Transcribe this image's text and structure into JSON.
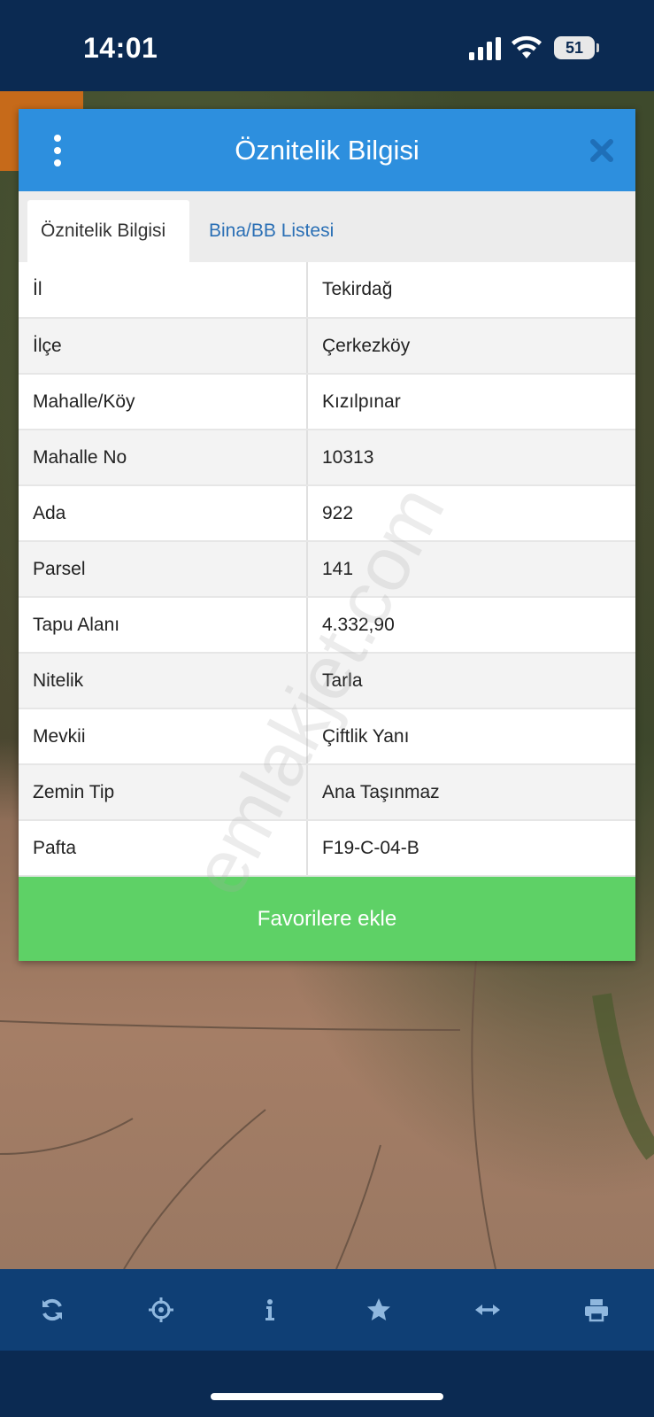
{
  "status_bar": {
    "time": "14:01",
    "battery_level": "51",
    "icons": [
      "signal-icon",
      "wifi-icon",
      "battery-icon"
    ]
  },
  "modal": {
    "title": "Öznitelik Bilgisi",
    "header_color": "#2d8fde",
    "icons": [
      "menu-icon",
      "close-icon"
    ],
    "tabs": [
      {
        "label": "Öznitelik Bilgisi",
        "active": true
      },
      {
        "label": "Bina/BB Listesi",
        "active": false
      }
    ],
    "rows": [
      {
        "key": "İl",
        "value": "Tekirdağ"
      },
      {
        "key": "İlçe",
        "value": "Çerkezköy"
      },
      {
        "key": "Mahalle/Köy",
        "value": "Kızılpınar"
      },
      {
        "key": "Mahalle No",
        "value": "10313"
      },
      {
        "key": "Ada",
        "value": "922"
      },
      {
        "key": "Parsel",
        "value": "141"
      },
      {
        "key": "Tapu Alanı",
        "value": "4.332,90"
      },
      {
        "key": "Nitelik",
        "value": "Tarla"
      },
      {
        "key": "Mevkii",
        "value": "Çiftlik Yanı"
      },
      {
        "key": "Zemin Tip",
        "value": "Ana Taşınmaz"
      },
      {
        "key": "Pafta",
        "value": "F19-C-04-B"
      }
    ],
    "favorite_button": "Favorilere ekle",
    "favorite_color": "#5ed166"
  },
  "toolbar": {
    "items": [
      "refresh-icon",
      "locate-icon",
      "info-icon",
      "star-icon",
      "measure-icon",
      "print-icon"
    ]
  },
  "watermark": "emlakjet.com"
}
